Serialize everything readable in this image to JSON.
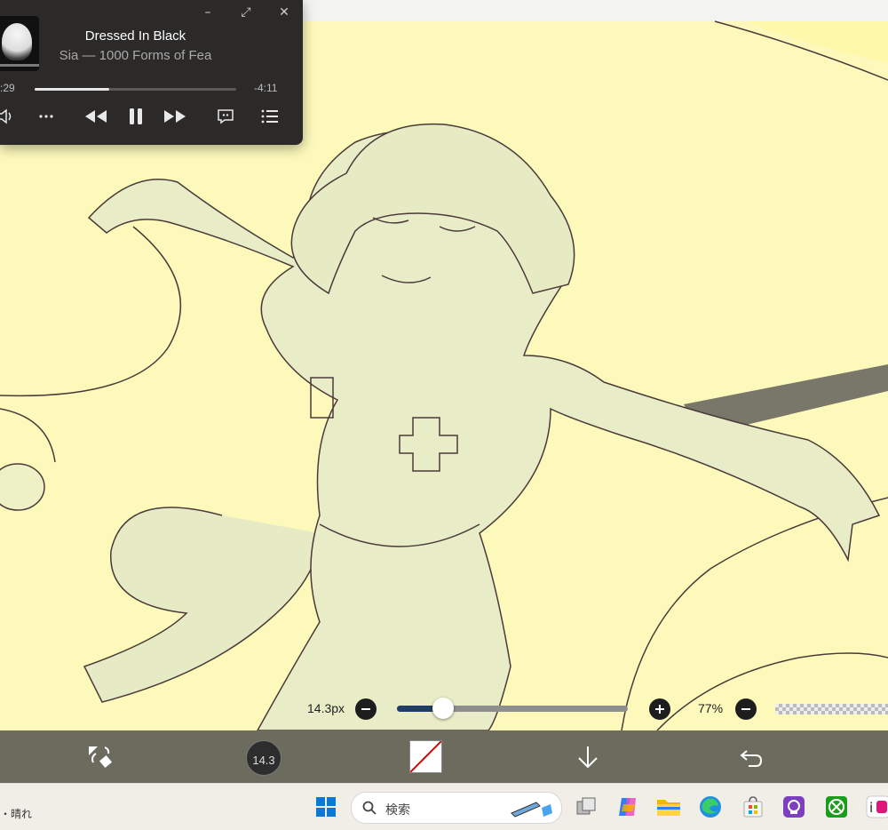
{
  "player": {
    "title": "Dressed In Black",
    "subtitle": "Sia — 1000 Forms of Fea",
    "elapsed": ":29",
    "remaining": "-4:11",
    "progress": 0.37,
    "window_buttons": {
      "minimize": "–",
      "expand": "⤢",
      "close": "✕"
    }
  },
  "brush": {
    "size_label": "14.3px",
    "size_slider": 0.2,
    "zoom_label": "77%",
    "cursor_size": "14.3"
  },
  "toolbar": {
    "tools": [
      "transform-eraser-icon",
      "brush-size-preview",
      "color-swatch",
      "download-icon",
      "undo-icon"
    ]
  },
  "taskbar": {
    "weather": "・晴れ",
    "search_placeholder": "検索",
    "icons": [
      "windows-start-icon",
      "search-icon",
      "task-view-icon",
      "copilot-icon",
      "file-explorer-icon",
      "edge-icon",
      "store-icon",
      "app-icon",
      "xbox-icon",
      "ibispaint-icon"
    ]
  },
  "colors": {
    "canvas": "#fdf9bb",
    "player_bg": "#2b2a29",
    "slider_fill": "#1f3d66",
    "toolbar_bg": "#5f5f56",
    "taskbar_bg": "#f1ede7"
  }
}
